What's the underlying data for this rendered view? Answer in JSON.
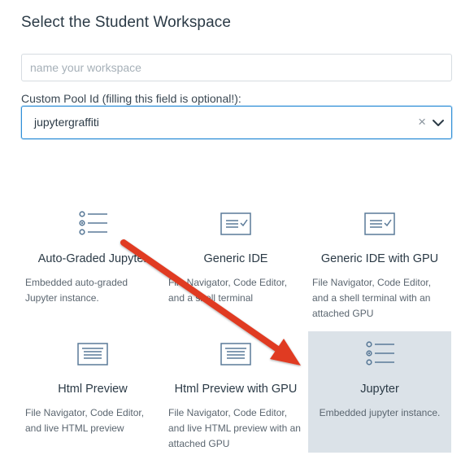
{
  "page": {
    "title": "Select the Student Workspace"
  },
  "workspace_name": {
    "value": "",
    "placeholder": "name your workspace"
  },
  "pool": {
    "label": "Custom Pool Id (filling this field is optional!):",
    "value": "jupytergraffiti",
    "clear_glyph": "×"
  },
  "cards": [
    {
      "title": "Auto-Graded Jupyter",
      "description": "Embedded auto-graded Jupyter instance.",
      "icon": "checklist-icon",
      "selected": false
    },
    {
      "title": "Generic IDE",
      "description": "File Navigator, Code Editor, and a shell terminal",
      "icon": "ide-window-icon",
      "selected": false
    },
    {
      "title": "Generic IDE with GPU",
      "description": "File Navigator, Code Editor, and a shell terminal with an attached GPU",
      "icon": "ide-window-icon",
      "selected": false
    },
    {
      "title": "Html Preview",
      "description": "File Navigator, Code Editor, and live HTML preview",
      "icon": "html-window-icon",
      "selected": false
    },
    {
      "title": "Html Preview with GPU",
      "description": "File Navigator, Code Editor, and live HTML preview with an attached GPU",
      "icon": "html-window-icon",
      "selected": false
    },
    {
      "title": "Jupyter",
      "description": "Embedded jupyter instance.",
      "icon": "checklist-icon",
      "selected": true
    }
  ],
  "colors": {
    "focus_border": "#2f8fd8",
    "icon_blue": "#5a7a98",
    "selected_bg": "#dbe2e8",
    "arrow_red": "#e03a24"
  }
}
